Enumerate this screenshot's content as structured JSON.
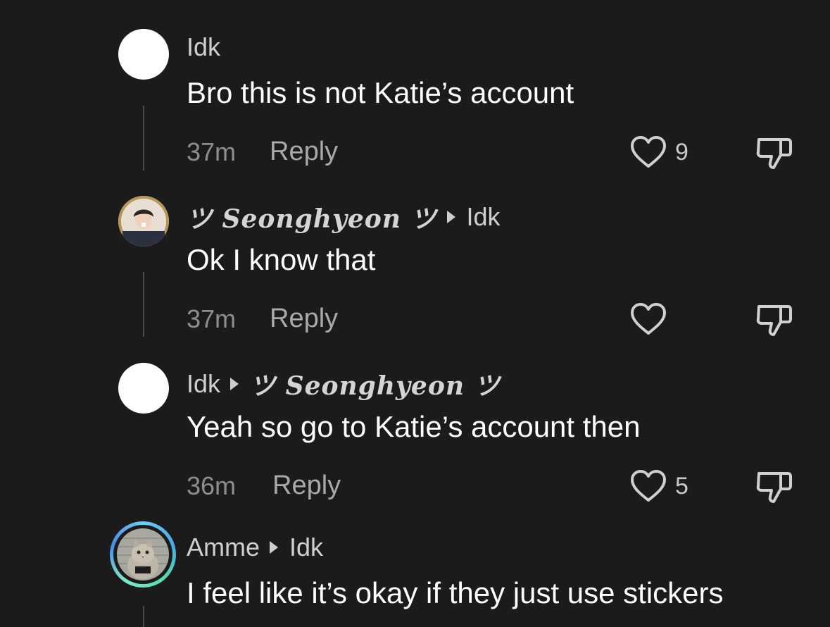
{
  "comments": [
    {
      "author": "Idk",
      "reply_to": "",
      "text": "Bro this is not Katie’s account",
      "time": "37m",
      "reply_label": "Reply",
      "likes": "9",
      "avatar": "blank-avatar"
    },
    {
      "author": "ツ Seonghyeon ツ",
      "reply_to": "Idk",
      "text": "Ok I know that",
      "time": "37m",
      "reply_label": "Reply",
      "likes": "",
      "avatar": "person-photo-avatar"
    },
    {
      "author": "Idk",
      "reply_to": "ツ Seonghyeon ツ",
      "text": "Yeah so go to Katie’s account then",
      "time": "36m",
      "reply_label": "Reply",
      "likes": "5",
      "avatar": "blank-avatar"
    },
    {
      "author": "Amme",
      "reply_to": "Idk",
      "text": "I feel like it’s okay if they just use stickers",
      "avatar": "cat-photo-avatar-with-story-ring"
    }
  ],
  "icons": {
    "like": "heart-outline-icon",
    "dislike": "thumbs-down-outline-icon",
    "reply_arrow": "triangle-right-icon"
  },
  "colors": {
    "background": "#1b1b1b",
    "text": "#ffffff",
    "muted": "#8e8e8e",
    "ring": "#6ad0f0"
  }
}
